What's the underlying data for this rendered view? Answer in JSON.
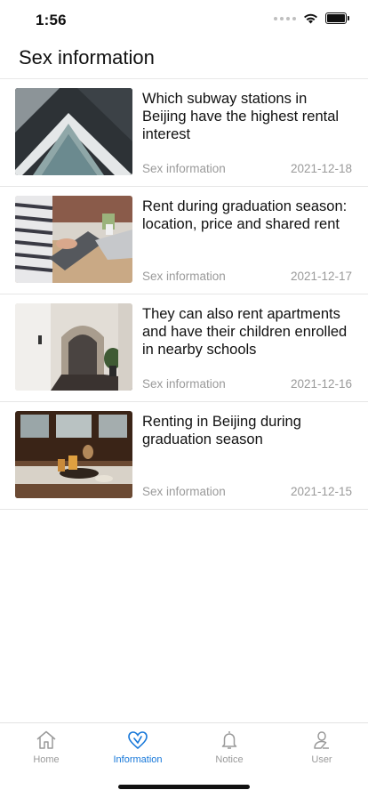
{
  "status_bar": {
    "time": "1:56"
  },
  "header": {
    "title": "Sex information"
  },
  "articles": [
    {
      "title": "Which subway stations in Beijing have the highest rental interest",
      "category": "Sex information",
      "date": "2021-12-18",
      "thumbnail": "building-facade"
    },
    {
      "title": "Rent during graduation season: location, price and shared rent",
      "category": "Sex information",
      "date": "2021-12-17",
      "thumbnail": "laptop-desk"
    },
    {
      "title": "They can also rent apartments and have their children enrolled in nearby schools",
      "category": "Sex information",
      "date": "2021-12-16",
      "thumbnail": "apartment-hallway"
    },
    {
      "title": "Renting in Beijing during graduation season",
      "category": "Sex information",
      "date": "2021-12-15",
      "thumbnail": "dining-table"
    }
  ],
  "tabbar": {
    "items": [
      {
        "label": "Home",
        "icon": "home-icon",
        "active": false
      },
      {
        "label": "Information",
        "icon": "heart-icon",
        "active": true
      },
      {
        "label": "Notice",
        "icon": "bell-icon",
        "active": false
      },
      {
        "label": "User",
        "icon": "user-icon",
        "active": false
      }
    ],
    "active_color": "#1677d9",
    "inactive_color": "#9a9a9a"
  }
}
